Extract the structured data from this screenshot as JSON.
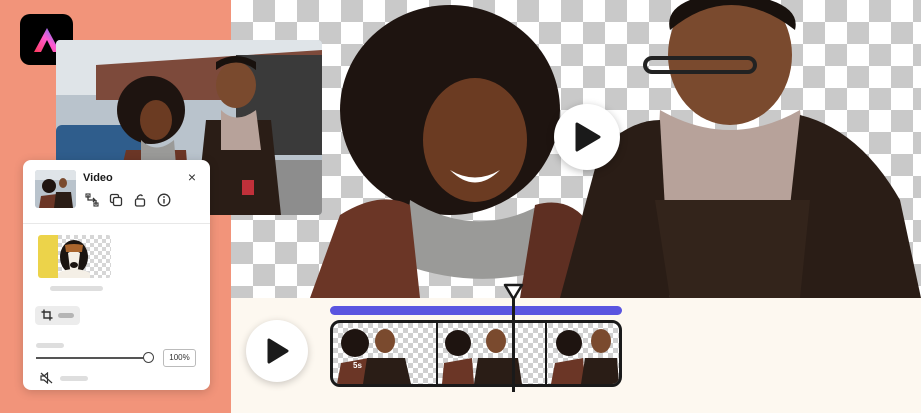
{
  "app": {
    "logo_icon": "adobe-express-logo-icon"
  },
  "colors": {
    "accent_purple": "#5a55e0",
    "left_bg": "#f2947a",
    "dark": "#1a1a1a"
  },
  "panel": {
    "title": "Video",
    "close_icon": "close-icon",
    "tools": [
      "replace-icon",
      "duplicate-icon",
      "lock-icon",
      "info-icon"
    ],
    "crop_icon": "crop-icon",
    "volume_value": "100%",
    "mute_icon": "mute-icon"
  },
  "timeline": {
    "frame_duration": "5s",
    "play_icon": "play-icon"
  }
}
